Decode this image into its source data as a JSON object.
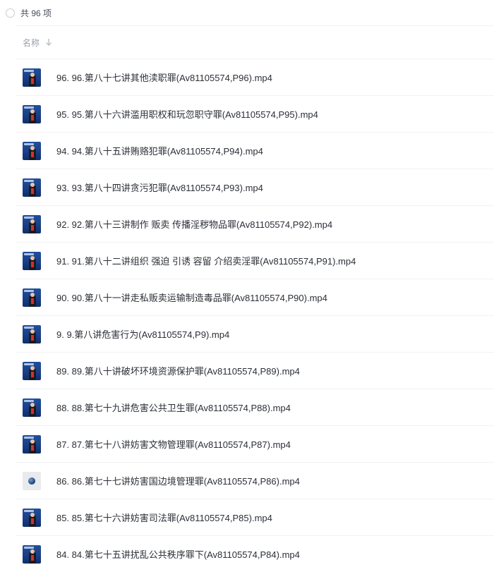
{
  "header": {
    "count_label": "共 96 项",
    "column_name": "名称"
  },
  "files": [
    {
      "name": "96. 96.第八十七讲其他渎职罪(Av81105574,P96).mp4",
      "thumb": "video"
    },
    {
      "name": "95. 95.第八十六讲滥用职权和玩忽职守罪(Av81105574,P95).mp4",
      "thumb": "video"
    },
    {
      "name": "94. 94.第八十五讲贿赂犯罪(Av81105574,P94).mp4",
      "thumb": "video"
    },
    {
      "name": "93. 93.第八十四讲贪污犯罪(Av81105574,P93).mp4",
      "thumb": "video"
    },
    {
      "name": "92. 92.第八十三讲制作 贩卖 传播淫秽物品罪(Av81105574,P92).mp4",
      "thumb": "video"
    },
    {
      "name": "91. 91.第八十二讲组织 强迫 引诱 容留 介绍卖淫罪(Av81105574,P91).mp4",
      "thumb": "video"
    },
    {
      "name": "90. 90.第八十一讲走私贩卖运输制造毒品罪(Av81105574,P90).mp4",
      "thumb": "video"
    },
    {
      "name": "9. 9.第八讲危害行为(Av81105574,P9).mp4",
      "thumb": "video"
    },
    {
      "name": "89. 89.第八十讲破坏环境资源保护罪(Av81105574,P89).mp4",
      "thumb": "video"
    },
    {
      "name": "88. 88.第七十九讲危害公共卫生罪(Av81105574,P88).mp4",
      "thumb": "video"
    },
    {
      "name": "87. 87.第七十八讲妨害文物管理罪(Av81105574,P87).mp4",
      "thumb": "video"
    },
    {
      "name": "86. 86.第七十七讲妨害国边境管理罪(Av81105574,P86).mp4",
      "thumb": "round"
    },
    {
      "name": "85. 85.第七十六讲妨害司法罪(Av81105574,P85).mp4",
      "thumb": "video"
    },
    {
      "name": "84. 84.第七十五讲扰乱公共秩序罪下(Av81105574,P84).mp4",
      "thumb": "video"
    }
  ]
}
